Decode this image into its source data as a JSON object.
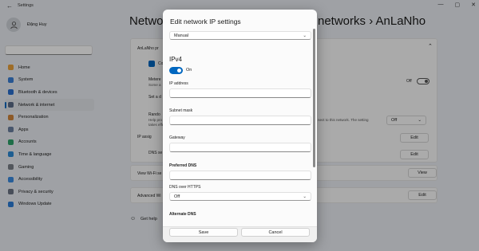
{
  "window": {
    "title": "Settings",
    "back": "←",
    "minimize": "—",
    "maximize": "▢",
    "close": "✕"
  },
  "profile": {
    "name": "Đặng Huy"
  },
  "nav": [
    {
      "label": "Home",
      "icon": "home-icon",
      "color": "#e9a13b"
    },
    {
      "label": "System",
      "icon": "system-icon",
      "color": "#3a7fd6"
    },
    {
      "label": "Bluetooth & devices",
      "icon": "bluetooth-icon",
      "color": "#2a6fcf"
    },
    {
      "label": "Network & internet",
      "icon": "network-icon",
      "color": "#5a6b86",
      "active": true
    },
    {
      "label": "Personalization",
      "icon": "brush-icon",
      "color": "#d0853b"
    },
    {
      "label": "Apps",
      "icon": "apps-icon",
      "color": "#6b7fa0"
    },
    {
      "label": "Accounts",
      "icon": "accounts-icon",
      "color": "#2fa36b"
    },
    {
      "label": "Time & language",
      "icon": "globe-icon",
      "color": "#2d8bd6"
    },
    {
      "label": "Gaming",
      "icon": "gaming-icon",
      "color": "#7a7f88"
    },
    {
      "label": "Accessibility",
      "icon": "accessibility-icon",
      "color": "#3a8be0"
    },
    {
      "label": "Privacy & security",
      "icon": "shield-icon",
      "color": "#6a7384"
    },
    {
      "label": "Windows Update",
      "icon": "update-icon",
      "color": "#2c7dd8"
    }
  ],
  "main": {
    "title_left": "Network",
    "title_right": "networks  ›  AnLaNho",
    "ssid_row": "AnLaNho pr",
    "connect_auto": "Co",
    "metered_label": "Metere",
    "metered_sub": "Some a",
    "metered_value": "Off",
    "set_data": "Set a d",
    "random_label": "Rando",
    "random_sub1": "Help pro",
    "random_sub2": "takes effe",
    "random_note": "nect to this network. The setting",
    "random_value": "Off",
    "ip_label": "IP assig",
    "dns_label": "DNS se",
    "view_label": "View Wi-Fi se",
    "adv_label": "Advanced Wi",
    "edit": "Edit",
    "view": "View",
    "get_help": "Get help"
  },
  "dialog": {
    "title": "Edit network IP settings",
    "mode_value": "Manual",
    "ipv4_heading": "IPv4",
    "ipv4_toggle": "On",
    "ip_label": "IP address",
    "subnet_label": "Subnet mask",
    "gateway_label": "Gateway",
    "pref_dns_label": "Preferred DNS",
    "dns_https_label": "DNS over HTTPS",
    "dns_https_value": "Off",
    "alt_dns_label": "Alternate DNS",
    "save": "Save",
    "cancel": "Cancel"
  }
}
